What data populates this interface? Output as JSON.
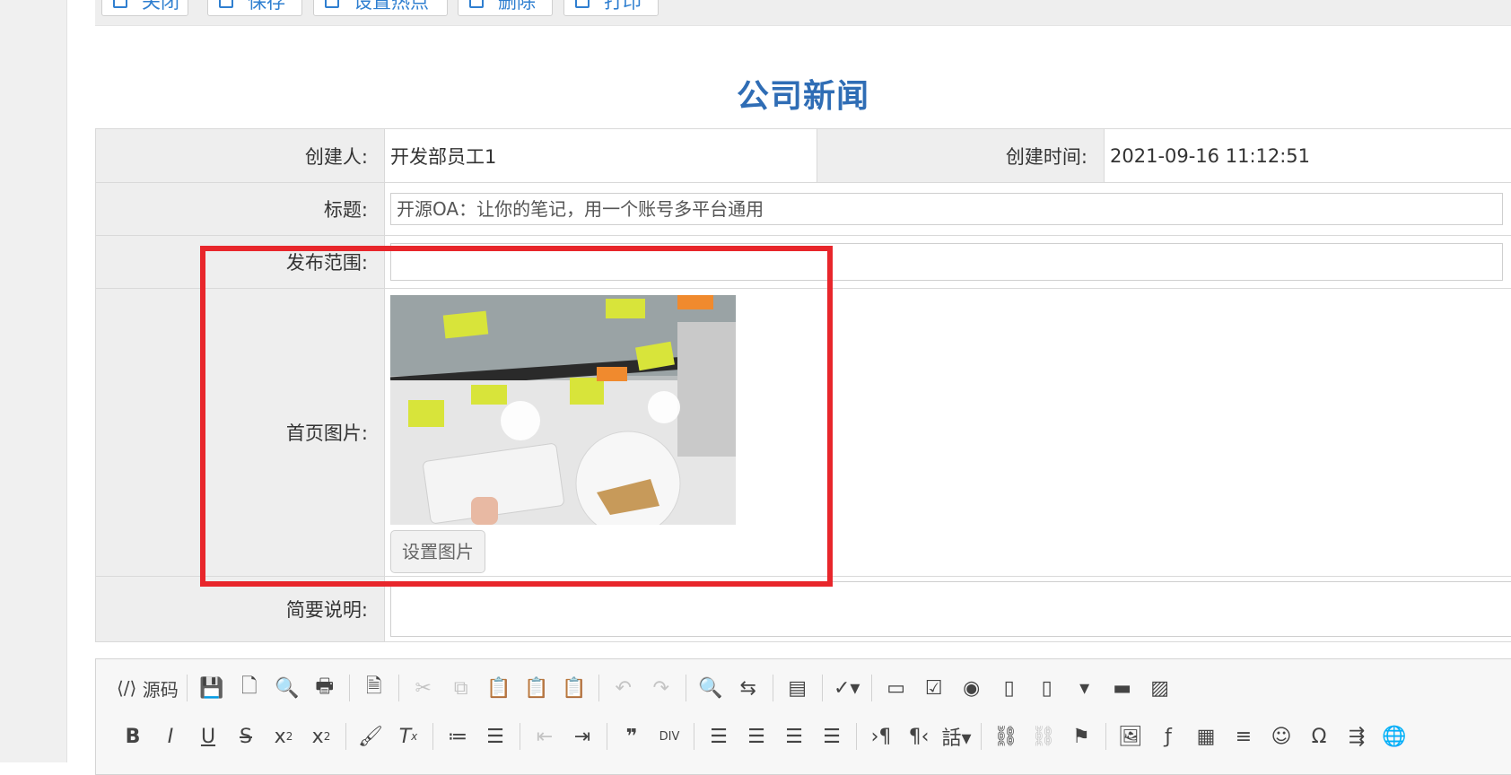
{
  "toolbar": {
    "buttons": [
      {
        "label": "关闭",
        "icon": "close-icon"
      },
      {
        "label": "保存",
        "icon": "save-icon"
      },
      {
        "label": "设置热点",
        "icon": "hotspot-icon"
      },
      {
        "label": "删除",
        "icon": "delete-icon"
      },
      {
        "label": "打印",
        "icon": "print-icon"
      }
    ]
  },
  "page_title": "公司新闻",
  "form": {
    "creator_label": "创建人:",
    "creator_value": "开发部员工1",
    "created_time_label": "创建时间:",
    "created_time_value": "2021-09-16 11:12:51",
    "title_label": "标题:",
    "title_value": "开源OA：让你的笔记，用一个账号多平台通用",
    "scope_label": "发布范围:",
    "scope_value": "",
    "cover_label": "首页图片:",
    "cover_button": "设置图片",
    "summary_label": "简要说明:",
    "summary_value": ""
  },
  "editor": {
    "source_label": "源码",
    "row1_icons": [
      "source-icon",
      "save-icon",
      "new-page-icon",
      "preview-icon",
      "print-icon",
      "templates-icon",
      "cut-icon",
      "copy-icon",
      "paste-icon",
      "paste-text-icon",
      "paste-word-icon",
      "undo-icon",
      "redo-icon",
      "find-icon",
      "replace-icon",
      "select-all-icon",
      "spellcheck-icon",
      "form-icon",
      "checkbox-icon",
      "radio-icon",
      "textfield-icon",
      "textarea-icon",
      "select-icon",
      "button-icon",
      "hidden-field-icon"
    ],
    "row2_icons": [
      "bold-icon",
      "italic-icon",
      "underline-icon",
      "strike-icon",
      "subscript-icon",
      "superscript-icon",
      "copy-format-icon",
      "remove-format-icon",
      "numbered-list-icon",
      "bulleted-list-icon",
      "outdent-icon",
      "indent-icon",
      "blockquote-icon",
      "div-icon",
      "align-left-icon",
      "align-center-icon",
      "align-right-icon",
      "justify-icon",
      "ltr-icon",
      "rtl-icon",
      "language-icon",
      "link-icon",
      "unlink-icon",
      "anchor-icon",
      "image-icon",
      "flash-icon",
      "table-icon",
      "hr-icon",
      "smiley-icon",
      "special-char-icon",
      "page-break-icon",
      "iframe-icon"
    ]
  },
  "colors": {
    "title": "#2f6db5",
    "toolbar_text": "#2f7fd0",
    "highlight": "#e8262b",
    "label_bg": "#eeeeee"
  }
}
